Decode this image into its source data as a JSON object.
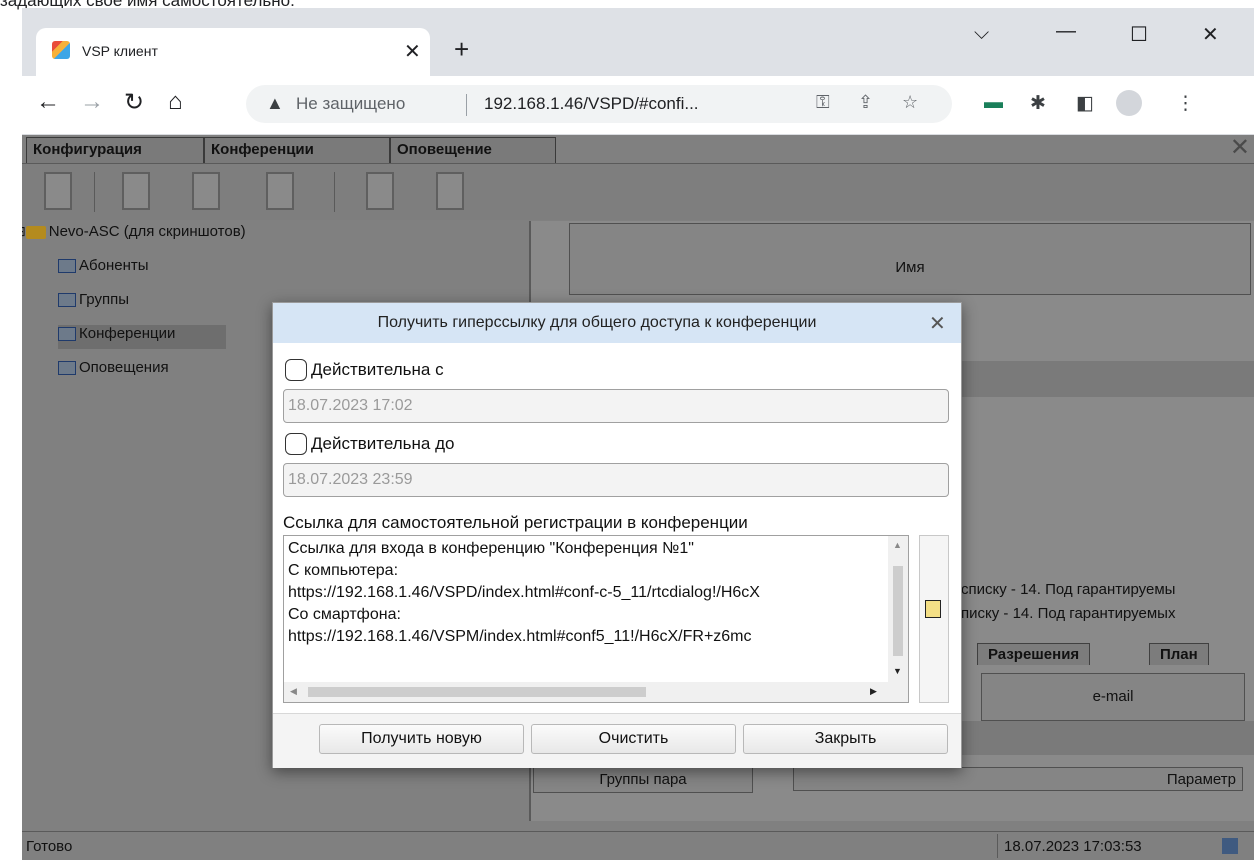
{
  "doc_snippet": "задающих свое имя самостоятельно.",
  "browser": {
    "tab_title": "VSP клиент",
    "new_tab_symbol": "+",
    "security_label": "Не защищено",
    "url": "192.168.1.46/VSPD/#confi..."
  },
  "app": {
    "tabs": [
      "Конфигурация",
      "Конференции",
      "Оповещение"
    ],
    "tree": {
      "root": "Nevo-ASC (для скриншотов)",
      "items": [
        "Абоненты",
        "Группы",
        "Конференции",
        "Оповещения"
      ]
    },
    "grid": {
      "name_header": "Имя",
      "info_line_1": "списку - 14. Под гарантируемы",
      "info_line_2": "писку - 14. Под гарантируемых",
      "tab_permissions": "Разрешения",
      "tab_plan": "План",
      "email_header": "e-mail",
      "groups_header": "Группы пара",
      "param_header": "Параметр"
    },
    "status": {
      "text": "Готово",
      "time": "18.07.2023 17:03:53"
    }
  },
  "dialog": {
    "title": "Получить гиперссылку для общего доступа к конференции",
    "valid_from_label": "Действительна с",
    "valid_from_value": "18.07.2023 17:02",
    "valid_from_checked": false,
    "valid_to_label": "Действительна до",
    "valid_to_value": "18.07.2023 23:59",
    "valid_to_checked": false,
    "link_caption": "Ссылка для самостоятельной регистрации в конференции",
    "link_lines": [
      "Ссылка для входа в конференцию \"Конференция №1\"",
      "С компьютера:",
      "https://192.168.1.46/VSPD/index.html#conf-c-5_11/rtcdialog!/H6cX",
      "Со смартфона:",
      "https://192.168.1.46/VSPM/index.html#conf5_11!/H6cX/FR+z6mc"
    ],
    "buttons": {
      "get_new": "Получить новую",
      "clear": "Очистить",
      "close": "Закрыть"
    }
  }
}
